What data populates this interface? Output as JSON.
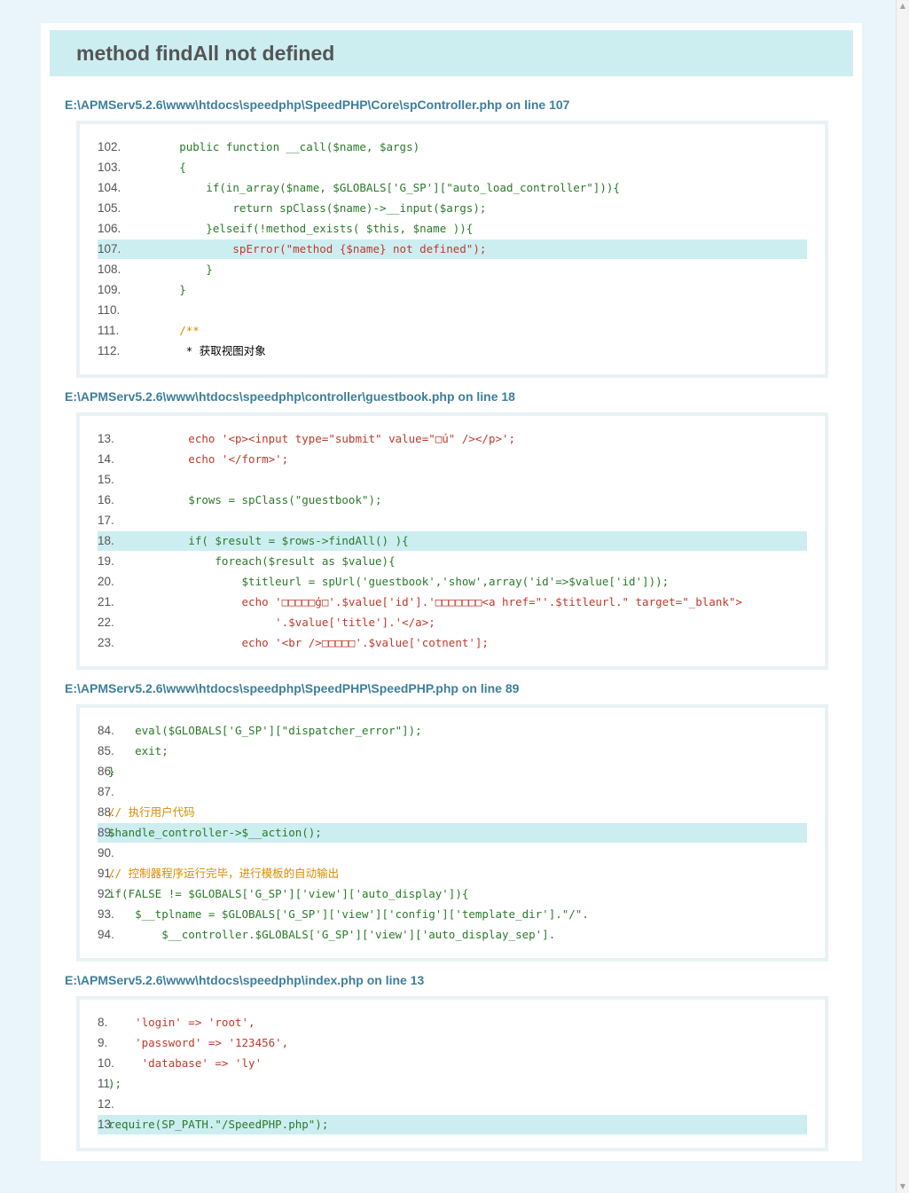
{
  "error": {
    "title": "method findAll not defined"
  },
  "traces": [
    {
      "file": "E:\\APMServ5.2.6\\www\\htdocs\\speedphp\\SpeedPHP\\Core\\spController.php on line 107",
      "lines": [
        {
          "num": "102.",
          "code": "        public function __call($name, $args)",
          "kind": "kw"
        },
        {
          "num": "103.",
          "code": "        {",
          "kind": "kw"
        },
        {
          "num": "104.",
          "code": "            if(in_array($name, $GLOBALS['G_SP'][\"auto_load_controller\"])){",
          "kind": "kw"
        },
        {
          "num": "105.",
          "code": "                return spClass($name)->__input($args);",
          "kind": "kw"
        },
        {
          "num": "106.",
          "code": "            }elseif(!method_exists( $this, $name )){",
          "kind": "kw"
        },
        {
          "num": "107.",
          "code": "                spError(\"method {$name} not defined\");",
          "kind": "str",
          "hl": true
        },
        {
          "num": "108.",
          "code": "            }",
          "kind": "kw"
        },
        {
          "num": "109.",
          "code": "        }",
          "kind": "kw"
        },
        {
          "num": "110.",
          "code": "",
          "kind": "kw"
        },
        {
          "num": "111.",
          "code": "        /**",
          "kind": "cmt"
        },
        {
          "num": "112.",
          "code": "         * 获取视图对象",
          "kind": "txt"
        }
      ]
    },
    {
      "file": "E:\\APMServ5.2.6\\www\\htdocs\\speedphp\\controller\\guestbook.php on line 18",
      "lines": [
        {
          "num": "13.",
          "code": "            echo '<p><input type=\"submit\" value=\"□ú\" /></p>';",
          "kind": "str"
        },
        {
          "num": "14.",
          "code": "            echo '</form>';",
          "kind": "str"
        },
        {
          "num": "15.",
          "code": "",
          "kind": "kw"
        },
        {
          "num": "16.",
          "code": "            $rows = spClass(\"guestbook\");",
          "kind": "kw"
        },
        {
          "num": "17.",
          "code": "",
          "kind": "kw"
        },
        {
          "num": "18.",
          "code": "            if( $result = $rows->findAll() ){",
          "kind": "kw",
          "hl": true
        },
        {
          "num": "19.",
          "code": "                foreach($result as $value){",
          "kind": "kw"
        },
        {
          "num": "20.",
          "code": "                    $titleurl = spUrl('guestbook','show',array('id'=>$value['id']));",
          "kind": "kw"
        },
        {
          "num": "21.",
          "code": "                    echo '□□□□□ģ□'.$value['id'].'□□□□□□□<a href=\"'.$titleurl.\" target=\"_blank\">",
          "kind": "str"
        },
        {
          "num": "22.",
          "code": "                         '.$value['title'].'</a>;",
          "kind": "str"
        },
        {
          "num": "23.",
          "code": "                    echo '<br />□□□□□'.$value['cotnent'];",
          "kind": "str"
        }
      ]
    },
    {
      "file": "E:\\APMServ5.2.6\\www\\htdocs\\speedphp\\SpeedPHP\\SpeedPHP.php on line 89",
      "lines": [
        {
          "num": "84.",
          "code": "    eval($GLOBALS['G_SP'][\"dispatcher_error\"]);",
          "kind": "kw"
        },
        {
          "num": "85.",
          "code": "    exit;",
          "kind": "kw"
        },
        {
          "num": "86.",
          "code": "}",
          "kind": "kw"
        },
        {
          "num": "87.",
          "code": "",
          "kind": "kw"
        },
        {
          "num": "88.",
          "code": "// 执行用户代码",
          "kind": "cmt"
        },
        {
          "num": "89.",
          "code": "$handle_controller->$__action();",
          "kind": "kw",
          "hl": true
        },
        {
          "num": "90.",
          "code": "",
          "kind": "kw"
        },
        {
          "num": "91.",
          "code": "// 控制器程序运行完毕，进行模板的自动输出",
          "kind": "cmt"
        },
        {
          "num": "92.",
          "code": "if(FALSE != $GLOBALS['G_SP']['view']['auto_display']){",
          "kind": "kw"
        },
        {
          "num": "93.",
          "code": "    $__tplname = $GLOBALS['G_SP']['view']['config']['template_dir'].\"/\".",
          "kind": "kw"
        },
        {
          "num": "94.",
          "code": "        $__controller.$GLOBALS['G_SP']['view']['auto_display_sep'].",
          "kind": "kw"
        }
      ]
    },
    {
      "file": "E:\\APMServ5.2.6\\www\\htdocs\\speedphp\\index.php on line 13",
      "lines": [
        {
          "num": "8.",
          "code": "    'login' => 'root',",
          "kind": "str"
        },
        {
          "num": "9.",
          "code": "    'password' => '123456',",
          "kind": "str"
        },
        {
          "num": "10.",
          "code": "     'database' => 'ly'",
          "kind": "str"
        },
        {
          "num": "11.",
          "code": ");",
          "kind": "kw"
        },
        {
          "num": "12.",
          "code": "",
          "kind": "kw"
        },
        {
          "num": "13.",
          "code": "require(SP_PATH.\"/SpeedPHP.php\");",
          "kind": "kw",
          "hl": true
        }
      ]
    }
  ]
}
